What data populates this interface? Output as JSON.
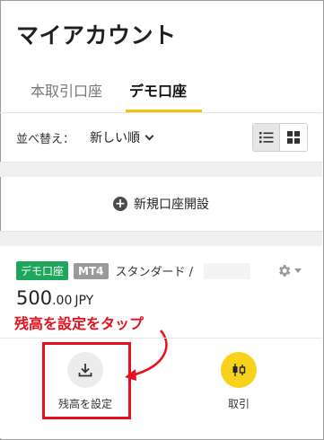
{
  "header": {
    "title": "マイアカウント"
  },
  "tabs": [
    {
      "label": "本取引口座",
      "active": false
    },
    {
      "label": "デモ口座",
      "active": true
    }
  ],
  "sort": {
    "label": "並べ替え：",
    "value": "新しい順"
  },
  "view_modes": [
    "list",
    "grid"
  ],
  "new_account": {
    "label": "新規口座開設"
  },
  "account": {
    "badge_type": "デモ口座",
    "badge_platform": "MT4",
    "type": "スタンダード /",
    "balance_int": "500",
    "balance_dec": ".00",
    "currency": "JPY"
  },
  "annotation": {
    "text": "残高を設定をタップ"
  },
  "actions": {
    "set_balance": "残高を設定",
    "trade": "取引"
  },
  "colors": {
    "accent": "#f1c40f",
    "demo_badge": "#1ea75a",
    "annotation_red": "#e8101c",
    "trade_button": "#f7d21b"
  }
}
